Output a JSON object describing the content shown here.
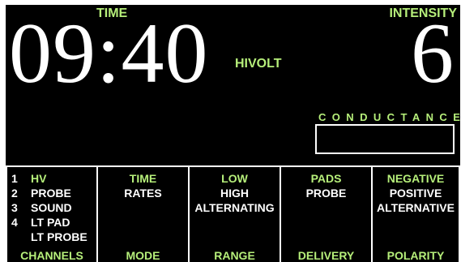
{
  "time": {
    "label": "TIME",
    "value": "09:40"
  },
  "mode_indicator": "HIVOLT",
  "intensity": {
    "label": "INTENSITY",
    "value": "6"
  },
  "conductance": {
    "label": "CONDUCTANCE"
  },
  "colors": {
    "accent": "#b6ef7a",
    "background": "#000000",
    "text": "#ffffff"
  },
  "panels": {
    "channels": {
      "title": "CHANNELS",
      "items": [
        {
          "num": "1",
          "label": "HV",
          "selected": true
        },
        {
          "num": "2",
          "label": "PROBE",
          "selected": false
        },
        {
          "num": "3",
          "label": "SOUND",
          "selected": false
        },
        {
          "num": "4",
          "label": "LT PAD",
          "selected": false
        },
        {
          "num": "",
          "label": "LT PROBE",
          "selected": false
        }
      ]
    },
    "mode": {
      "title": "MODE",
      "options": [
        "TIME",
        "RATES"
      ],
      "selected": "TIME"
    },
    "range": {
      "title": "RANGE",
      "options": [
        "LOW",
        "HIGH",
        "ALTERNATING"
      ],
      "selected": "LOW"
    },
    "delivery": {
      "title": "DELIVERY",
      "options": [
        "PADS",
        "PROBE"
      ],
      "selected": "PADS"
    },
    "polarity": {
      "title": "POLARITY",
      "options": [
        "NEGATIVE",
        "POSITIVE",
        "ALTERNATIVE"
      ],
      "selected": "NEGATIVE"
    }
  }
}
